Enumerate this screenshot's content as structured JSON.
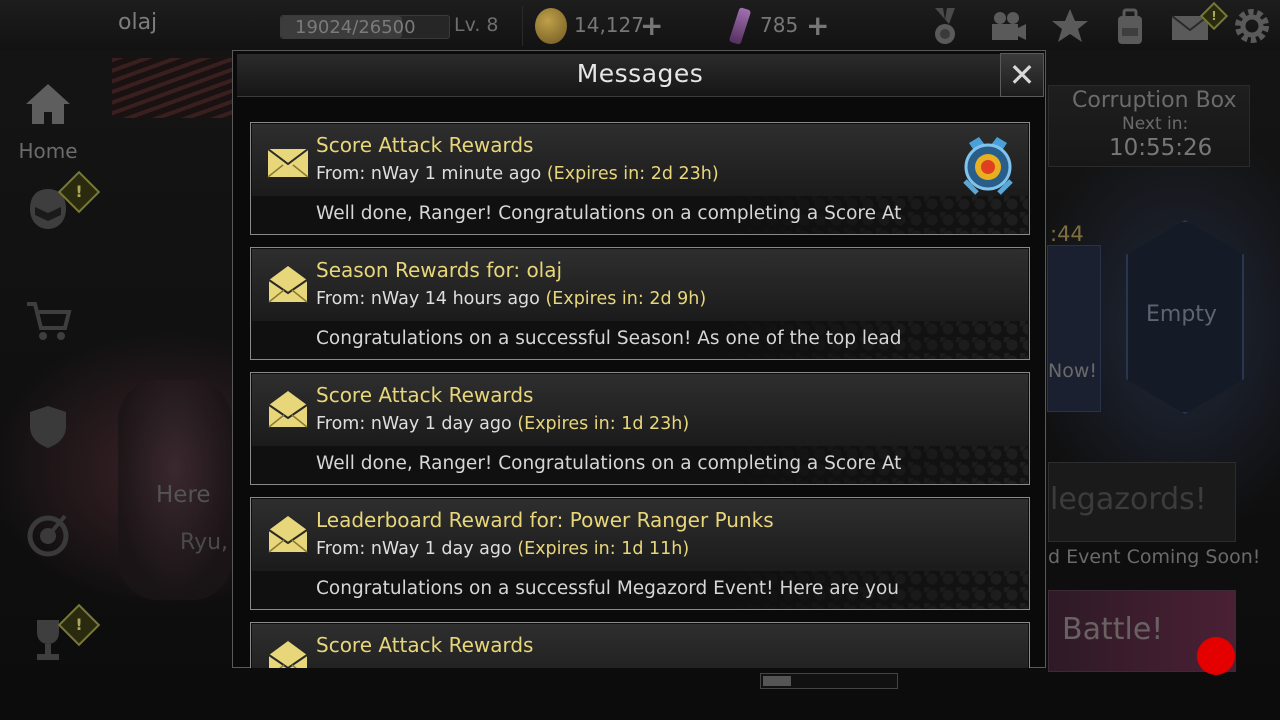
{
  "topbar": {
    "username": "olaj",
    "xp": "19024/26500",
    "xp_progress": 0.718,
    "level": "Lv. 8",
    "coins": "14,127",
    "crystals": "785",
    "plus_symbol": "+"
  },
  "sidebar": {
    "home_label": "Home",
    "alert_mark": "!"
  },
  "right_panel": {
    "box_title": "Corruption Box",
    "next_in": "Next in:",
    "timer": "10:55:26",
    "timer_partial": ":44",
    "now_partial": "Now!",
    "empty_label": "Empty",
    "megazord_partial": "legazords!",
    "event_partial": "d Event Coming Soon!",
    "battle_label": "Battle!"
  },
  "background": {
    "here_partial": "Here",
    "ryu_partial": "Ryu,"
  },
  "modal": {
    "title": "Messages",
    "close_label": "✕",
    "messages": [
      {
        "subject": "Score Attack Rewards",
        "from": "From: nWay 1 minute ago",
        "expires": "(Expires in: 2d 23h)",
        "preview": "Well done, Ranger! Congratulations on a completing a Score At",
        "unread": true
      },
      {
        "subject": "Season Rewards for: olaj",
        "from": "From: nWay 14 hours ago",
        "expires": "(Expires in: 2d 9h)",
        "preview": "Congratulations on a successful Season! As one of the top lead",
        "unread": false
      },
      {
        "subject": "Score Attack Rewards",
        "from": "From: nWay 1 day ago",
        "expires": "(Expires in: 1d 23h)",
        "preview": "Well done, Ranger! Congratulations on a completing a Score At",
        "unread": false
      },
      {
        "subject": "Leaderboard Reward for: Power Ranger Punks",
        "from": "From: nWay 1 day ago",
        "expires": "(Expires in: 1d 11h)",
        "preview": "Congratulations on a successful Megazord Event! Here are you",
        "unread": false
      },
      {
        "subject": "Score Attack Rewards",
        "from": "",
        "expires": "",
        "preview": "",
        "unread": false
      }
    ]
  },
  "colors": {
    "accent_gold": "#e8d67a",
    "record_dot": "#e50000"
  }
}
